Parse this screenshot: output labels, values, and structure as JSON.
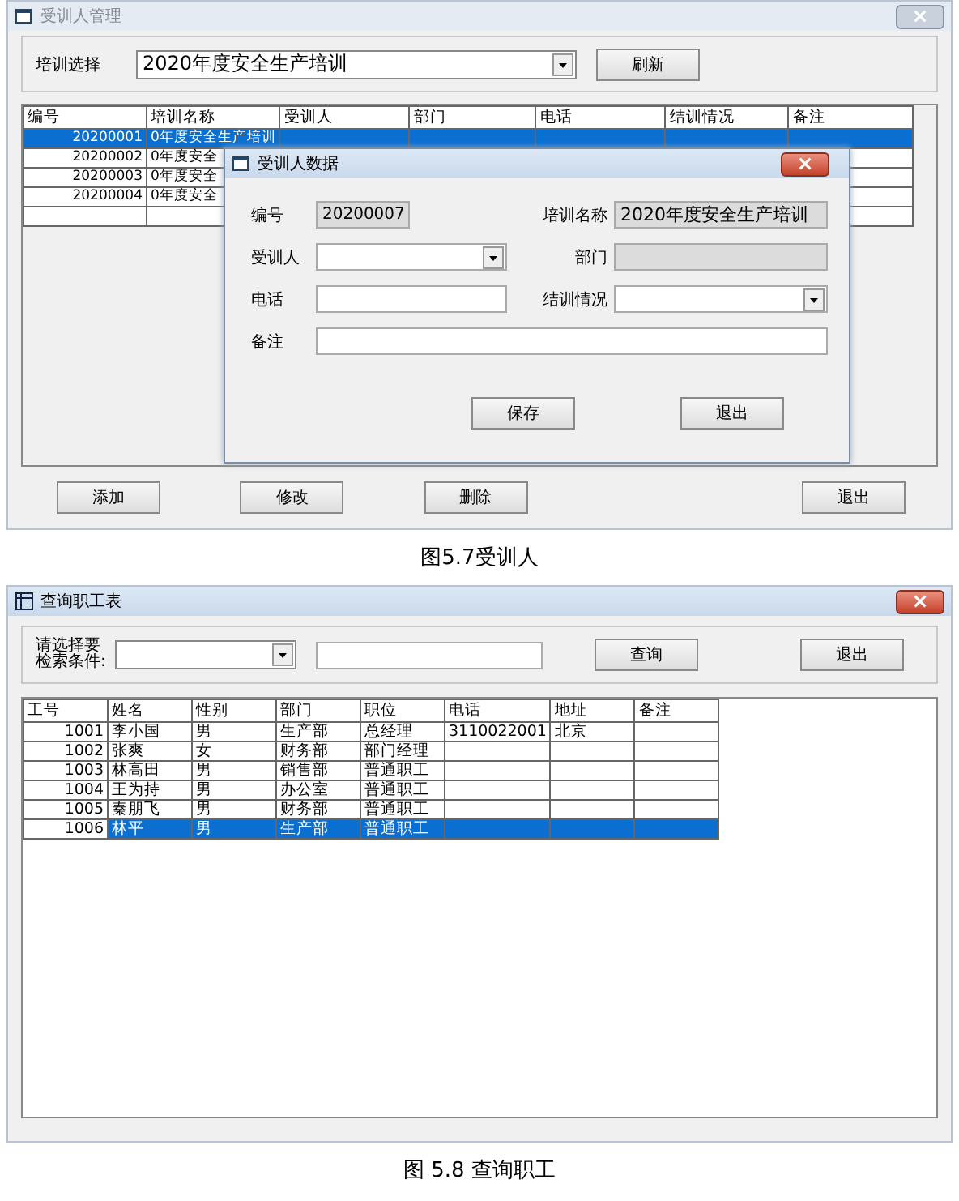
{
  "training_window": {
    "title": "受训人管理",
    "active": false,
    "filter_label": "培训选择",
    "filter_value": "2020年度安全生产培训",
    "refresh_button": "刷新",
    "table": {
      "columns": [
        "编号",
        "培训名称",
        "受训人",
        "部门",
        "电话",
        "结训情况",
        "备注"
      ],
      "rows": [
        {
          "cells": [
            "20200001",
            "0年度安全生产培训"
          ],
          "selected": true
        },
        {
          "cells": [
            "20200002",
            "0年度安全"
          ],
          "selected": false
        },
        {
          "cells": [
            "20200003",
            "0年度安全"
          ],
          "selected": false
        },
        {
          "cells": [
            "20200004",
            "0年度安全"
          ],
          "selected": false
        },
        {
          "cells": [],
          "selected": false
        }
      ]
    },
    "dialog": {
      "title": "受训人数据",
      "active": true,
      "fields": [
        {
          "label": "编号",
          "value": "20200007",
          "kind": "readonly"
        },
        {
          "label": "培训名称",
          "value": "2020年度安全生产培训",
          "kind": "readonly"
        },
        {
          "label": "受训人",
          "kind": "combo"
        },
        {
          "label": "部门",
          "kind": "readonly"
        },
        {
          "label": "电话",
          "kind": "text"
        },
        {
          "label": "结训情况",
          "kind": "combo"
        },
        {
          "label": "备注",
          "kind": "text"
        }
      ],
      "buttons": [
        "保存",
        "退出"
      ]
    },
    "buttons": [
      "添加",
      "修改",
      "删除",
      "退出"
    ]
  },
  "caption_1": "图5.7受训人",
  "employee_window": {
    "title": "查询职工表",
    "active": true,
    "filter_label": "请选择要检索条件:",
    "search_button": "查询",
    "exit_button": "退出",
    "table": {
      "columns": [
        "工号",
        "姓名",
        "性别",
        "部门",
        "职位",
        "电话",
        "地址",
        "备注"
      ],
      "rows": [
        {
          "cells": [
            "1001",
            "李小国",
            "男",
            "生产部",
            "总经理",
            "3110022001",
            "北京",
            ""
          ],
          "selected": false
        },
        {
          "cells": [
            "1002",
            "张爽",
            "女",
            "财务部",
            "部门经理",
            "",
            "",
            ""
          ],
          "selected": false
        },
        {
          "cells": [
            "1003",
            "林高田",
            "男",
            "销售部",
            "普通职工",
            "",
            "",
            ""
          ],
          "selected": false
        },
        {
          "cells": [
            "1004",
            "王为持",
            "男",
            "办公室",
            "普通职工",
            "",
            "",
            ""
          ],
          "selected": false
        },
        {
          "cells": [
            "1005",
            "秦朋飞",
            "男",
            "财务部",
            "普通职工",
            "",
            "",
            ""
          ],
          "selected": false
        },
        {
          "cells": [
            "1006",
            "林平",
            "男",
            "生产部",
            "普通职工",
            "",
            "",
            ""
          ],
          "selected": true
        }
      ]
    }
  },
  "caption_2": "图 5.8 查询职工"
}
